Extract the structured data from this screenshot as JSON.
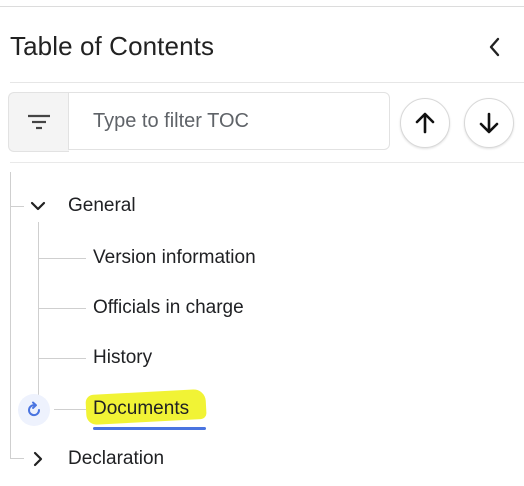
{
  "header": {
    "title": "Table of Contents"
  },
  "filter": {
    "placeholder": "Type to filter TOC"
  },
  "icons": {
    "collapse": "chevron-left-icon",
    "filter": "filter-lines-icon",
    "up": "arrow-up-icon",
    "down": "arrow-down-icon",
    "expanded": "chevron-down-icon",
    "collapsed": "chevron-right-icon",
    "reload": "refresh-icon"
  },
  "colors": {
    "highlight": "#f0f22a",
    "active_underline": "#4a74e0",
    "reload_icon": "#4a74e0"
  },
  "toc": {
    "general": {
      "label": "General",
      "children": [
        "Version information",
        "Officials in charge",
        "History",
        "Documents"
      ]
    },
    "declaration": {
      "label": "Declaration"
    }
  }
}
